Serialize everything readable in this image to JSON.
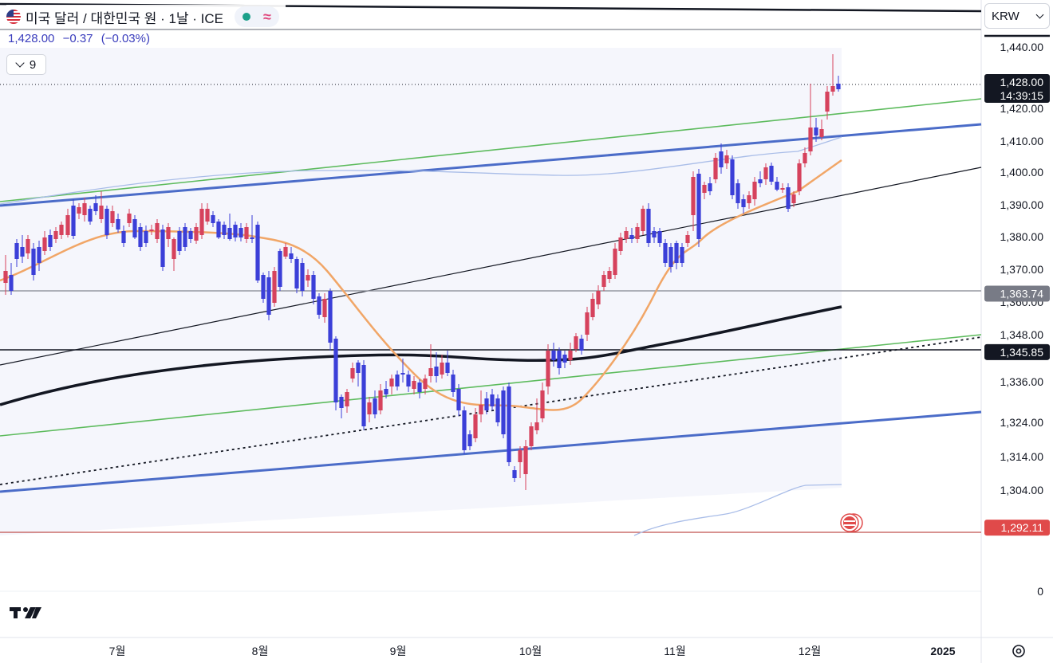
{
  "header": {
    "title": "미국 달러 / 대한민국 원 · 1날 · ICE",
    "status_wave": "≈"
  },
  "quote": {
    "price": "1,428.00",
    "change": "−0.37",
    "change_pct": "(−0.03%)"
  },
  "indicator_toggle": {
    "count": "9"
  },
  "currency_select": {
    "value": "KRW"
  },
  "price_scale": {
    "ticks": [
      "1,440.00",
      "1,420.00",
      "1,410.00",
      "1,400.00",
      "1,390.00",
      "1,380.00",
      "1,370.00",
      "1,360.00",
      "1,348.00",
      "1,336.00",
      "1,324.00",
      "1,314.00",
      "1,304.00",
      "1,292.00",
      "0"
    ],
    "labels": [
      {
        "text": "1,428.00",
        "sub": "14:39:15",
        "bg": "#131722",
        "fg": "#ffffff",
        "value": 1428
      },
      {
        "text": "1,363.74",
        "sub": "",
        "bg": "#787b86",
        "fg": "#ffffff",
        "value": 1363.74
      },
      {
        "text": "1,345.85",
        "sub": "",
        "bg": "#131722",
        "fg": "#ffffff",
        "value": 1345.85
      },
      {
        "text": "1,292.11",
        "sub": "",
        "bg": "#e04a4a",
        "fg": "#ffffff",
        "value": 1292.11
      }
    ]
  },
  "time_scale": {
    "labels": [
      "7월",
      "8월",
      "9월",
      "10월",
      "11월",
      "12월",
      "2025"
    ]
  },
  "colors": {
    "up": "#d6425d",
    "down": "#3b3fd8",
    "ma_orange": "#f1a667",
    "ma_black": "#131722",
    "bb_line": "#a9bde8",
    "channel_blue": "#4b6cc8",
    "channel_green": "#5dbb5d",
    "band_fill": "#eceef9"
  },
  "icons": [
    "us-flag-icon",
    "status-dot-icon",
    "wave-icon",
    "chevron-down-icon",
    "tradingview-logo-icon",
    "settings-gear-icon",
    "event-flag-icon"
  ]
}
